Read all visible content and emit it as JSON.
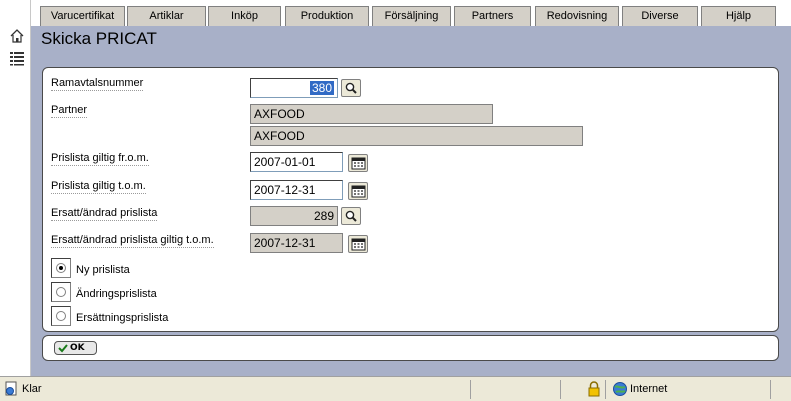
{
  "tabs": [
    {
      "label": "Varucertifikat"
    },
    {
      "label": "Artiklar"
    },
    {
      "label": "Inköp"
    },
    {
      "label": "Produktion"
    },
    {
      "label": "Försäljning"
    },
    {
      "label": "Partners"
    },
    {
      "label": "Redovisning"
    },
    {
      "label": "Diverse"
    },
    {
      "label": "Hjälp"
    }
  ],
  "leftbar": {
    "icons": [
      "home-icon",
      "list-icon"
    ]
  },
  "page": {
    "title": "Skicka PRICAT"
  },
  "form": {
    "ramavtal": {
      "label": "Ramavtalsnummer",
      "value": "380"
    },
    "partner": {
      "label": "Partner",
      "value1": "AXFOOD",
      "value2": "AXFOOD"
    },
    "from": {
      "label": "Prislista giltig fr.o.m.",
      "value": "2007-01-01"
    },
    "tom": {
      "label": "Prislista giltig t.o.m.",
      "value": "2007-12-31"
    },
    "ersatt": {
      "label": "Ersatt/ändrad prislista",
      "value": "289"
    },
    "ersatt_tom": {
      "label": "Ersatt/ändrad prislista giltig t.o.m.",
      "value": "2007-12-31"
    },
    "radios": [
      {
        "label": "Ny prislista",
        "checked": true
      },
      {
        "label": "Ändringsprislista",
        "checked": false
      },
      {
        "label": "Ersättningsprislista",
        "checked": false
      }
    ]
  },
  "buttons": {
    "ok": "OK"
  },
  "status": {
    "text": "Klar",
    "zone": "Internet"
  }
}
